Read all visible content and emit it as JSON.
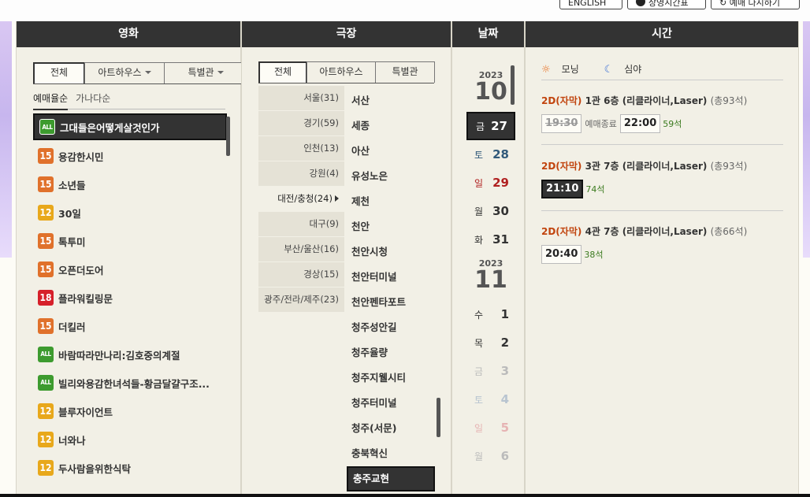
{
  "top_buttons": [
    {
      "label": "ENGLISH"
    },
    {
      "label": "상영시간표"
    },
    {
      "label": "예매 다시하기"
    }
  ],
  "columns": {
    "movie": "영화",
    "theater": "극장",
    "date": "날짜",
    "time": "시간"
  },
  "movie_tabs": [
    {
      "label": "전체",
      "active": true
    },
    {
      "label": "아트하우스",
      "dropdown": true
    },
    {
      "label": "특별관",
      "dropdown": true
    }
  ],
  "sort_tabs": [
    {
      "label": "예매율순",
      "active": true
    },
    {
      "label": "가나다순"
    }
  ],
  "movies": [
    {
      "rating": "ALL",
      "title": "그대들은어떻게살것인가",
      "selected": true
    },
    {
      "rating": "15",
      "title": "용감한시민"
    },
    {
      "rating": "15",
      "title": "소년들"
    },
    {
      "rating": "12",
      "title": "30일"
    },
    {
      "rating": "15",
      "title": "톡투미"
    },
    {
      "rating": "15",
      "title": "오픈더도어"
    },
    {
      "rating": "18",
      "title": "플라워킬링문"
    },
    {
      "rating": "15",
      "title": "더킬러"
    },
    {
      "rating": "ALL",
      "title": "바람따라만나리:김호중의계절"
    },
    {
      "rating": "ALL",
      "title": "빌리와용감한녀석들-황금달걀구조..."
    },
    {
      "rating": "12",
      "title": "블루자이언트"
    },
    {
      "rating": "12",
      "title": "너와나"
    },
    {
      "rating": "12",
      "title": "두사람을위한식탁"
    }
  ],
  "rating_colors": {
    "ALL": "#3d9b2f",
    "12": "#e8a81b",
    "15": "#e0712b",
    "18": "#d6202a"
  },
  "theater_tabs": [
    {
      "label": "전체",
      "active": true
    },
    {
      "label": "아트하우스"
    },
    {
      "label": "특별관"
    }
  ],
  "regions": [
    {
      "label": "서울(31)"
    },
    {
      "label": "경기(59)"
    },
    {
      "label": "인천(13)"
    },
    {
      "label": "강원(4)"
    },
    {
      "label": "대전/충청(24)",
      "active": true
    },
    {
      "label": "대구(9)"
    },
    {
      "label": "부산/울산(16)"
    },
    {
      "label": "경상(15)"
    },
    {
      "label": "광주/전라/제주(23)"
    }
  ],
  "cinemas": [
    {
      "label": "서산"
    },
    {
      "label": "세종"
    },
    {
      "label": "아산"
    },
    {
      "label": "유성노은"
    },
    {
      "label": "제천"
    },
    {
      "label": "천안"
    },
    {
      "label": "천안시청"
    },
    {
      "label": "천안터미널"
    },
    {
      "label": "천안펜타포트"
    },
    {
      "label": "청주성안길"
    },
    {
      "label": "청주율량"
    },
    {
      "label": "청주지웰시티"
    },
    {
      "label": "청주터미널"
    },
    {
      "label": "청주(서문)"
    },
    {
      "label": "충북혁신"
    },
    {
      "label": "충주교현",
      "selected": true
    }
  ],
  "dates": [
    {
      "year": "2023",
      "month": "10",
      "days": [
        {
          "wd": "금",
          "num": "27",
          "type": "",
          "selected": true
        },
        {
          "wd": "토",
          "num": "28",
          "type": "sat"
        },
        {
          "wd": "일",
          "num": "29",
          "type": "sun"
        },
        {
          "wd": "월",
          "num": "30",
          "type": ""
        },
        {
          "wd": "화",
          "num": "31",
          "type": ""
        }
      ]
    },
    {
      "year": "2023",
      "month": "11",
      "days": [
        {
          "wd": "수",
          "num": "1",
          "type": ""
        },
        {
          "wd": "목",
          "num": "2",
          "type": ""
        },
        {
          "wd": "금",
          "num": "3",
          "type": "",
          "disabled": true
        },
        {
          "wd": "토",
          "num": "4",
          "type": "sat",
          "disabled": true
        },
        {
          "wd": "일",
          "num": "5",
          "type": "sun",
          "disabled": true
        },
        {
          "wd": "월",
          "num": "6",
          "type": "",
          "disabled": true
        }
      ]
    }
  ],
  "legend": {
    "morning": "모닝",
    "night": "심야"
  },
  "shows": [
    {
      "format": "2D(자막)",
      "hall": "1관 6층 (리클라이너,Laser)",
      "capacity": "(총93석)",
      "times": [
        {
          "time": "19:30",
          "closed": true,
          "note": "예매종료"
        },
        {
          "time": "22:00",
          "seats": "59석"
        }
      ]
    },
    {
      "format": "2D(자막)",
      "hall": "3관 7층 (리클라이너,Laser)",
      "capacity": "(총93석)",
      "times": [
        {
          "time": "21:10",
          "seats": "74석",
          "selected": true
        }
      ]
    },
    {
      "format": "2D(자막)",
      "hall": "4관 7층 (리클라이너,Laser)",
      "capacity": "(총66석)",
      "times": [
        {
          "time": "20:40",
          "seats": "38석"
        }
      ]
    }
  ]
}
